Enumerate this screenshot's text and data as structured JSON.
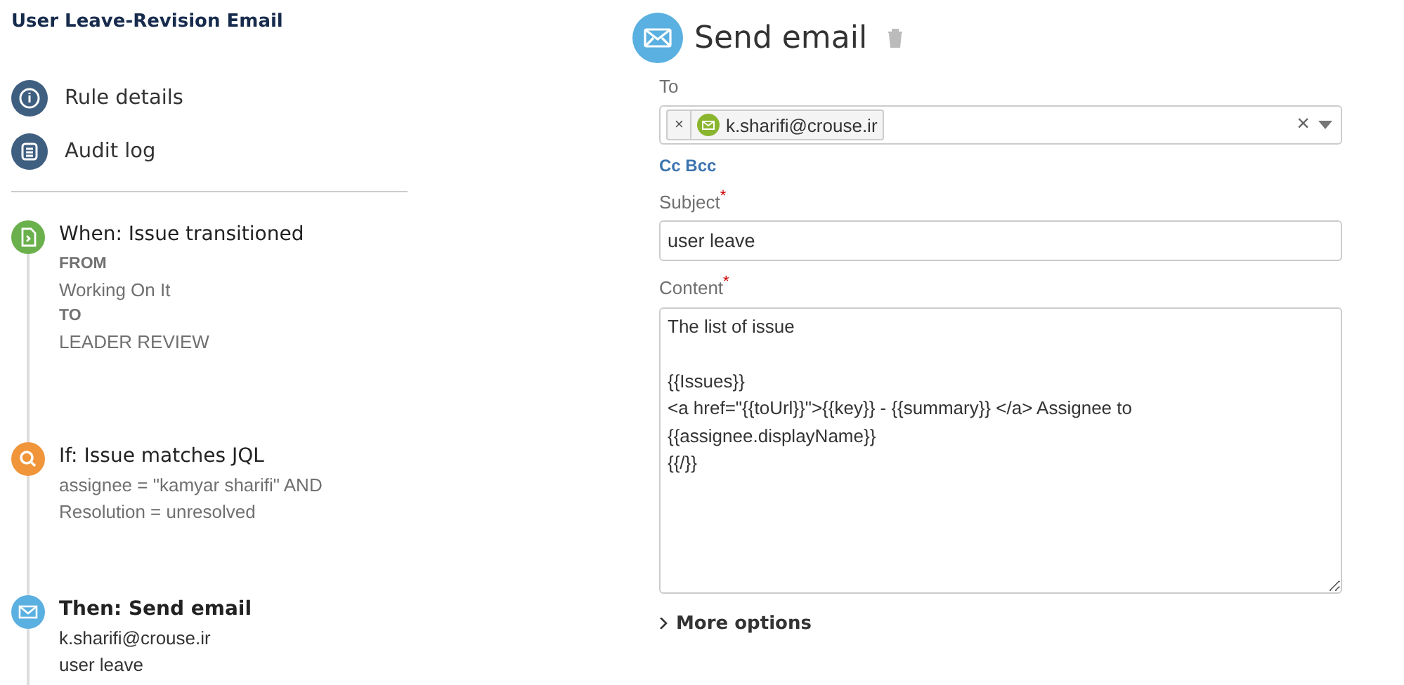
{
  "rule_title": "User Leave-Revision Email",
  "nav": [
    {
      "kind": "info",
      "label": "Rule details"
    },
    {
      "kind": "log",
      "label": "Audit log"
    }
  ],
  "steps": [
    {
      "kind": "trigger",
      "color": "#6ab04c",
      "title": "When: Issue transitioned",
      "selected": false,
      "lines": [
        {
          "kind": "label",
          "text": "FROM"
        },
        {
          "kind": "value",
          "text": "Working On It"
        },
        {
          "kind": "label",
          "text": "TO"
        },
        {
          "kind": "value",
          "text": "LEADER REVIEW"
        }
      ]
    },
    {
      "kind": "condition",
      "color": "#f0953a",
      "title": "If: Issue matches JQL",
      "selected": false,
      "lines": [
        {
          "kind": "value",
          "text": "assignee = \"kamyar sharifi\" AND"
        },
        {
          "kind": "value",
          "text": "Resolution = unresolved"
        }
      ]
    },
    {
      "kind": "action",
      "color": "#5ab0e0",
      "title": "Then: Send email",
      "selected": true,
      "lines": [
        {
          "kind": "plain",
          "text": "k.sharifi@crouse.ir"
        },
        {
          "kind": "plain",
          "text": "user leave"
        }
      ]
    }
  ],
  "panel": {
    "title": "Send email",
    "to": {
      "label": "To",
      "recipients": [
        {
          "remove": "×",
          "email": "k.sharifi@crouse.ir"
        }
      ],
      "clear": "×"
    },
    "cc_bcc": "Cc Bcc",
    "required_mark": "*",
    "subject": {
      "label": "Subject",
      "required": true,
      "value": "user leave"
    },
    "content": {
      "label": "Content",
      "required": true,
      "value": "The list of issue\n\n{{Issues}}\n<a href=\"{{toUrl}}\">{{key}} - {{summary}} </a> Assignee to\n{{assignee.displayName}}\n{{/}}"
    },
    "more_options": {
      "label": "More options",
      "expanded": false
    }
  }
}
